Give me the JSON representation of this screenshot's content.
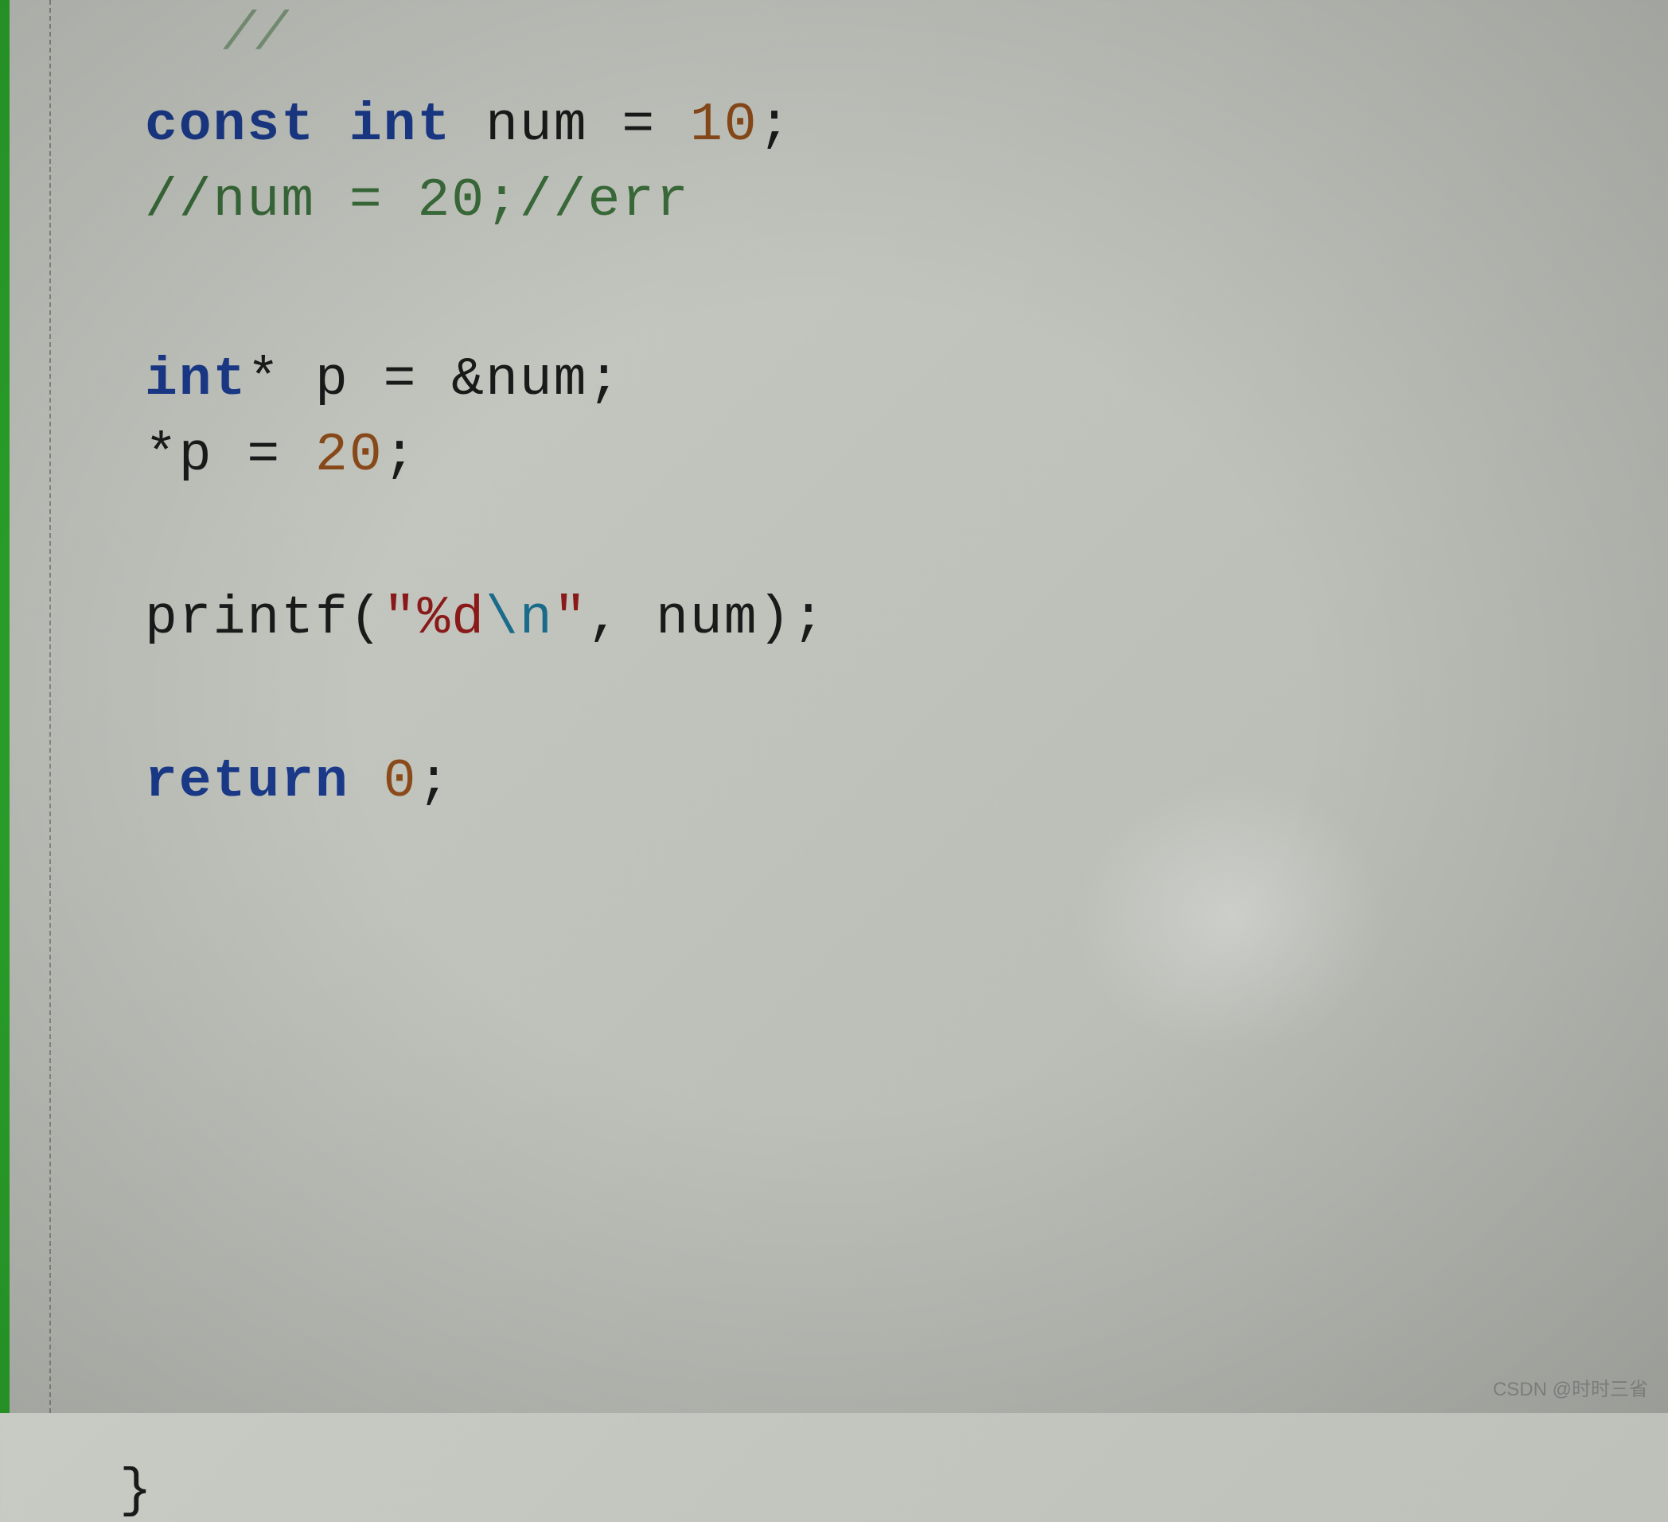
{
  "code": {
    "top_partial": "//",
    "line1": {
      "indent": "  ",
      "kw_const": "const",
      "sp1": " ",
      "kw_int": "int",
      "sp2": " ",
      "var": "num = ",
      "num": "10",
      "semi": ";"
    },
    "line2": {
      "indent": "  ",
      "comment": "//num = 20;//err"
    },
    "line3": {
      "indent": "  ",
      "kw_int": "int",
      "rest": "* p = &num;"
    },
    "line4": {
      "indent": "  ",
      "text": "*p = ",
      "num": "20",
      "semi": ";"
    },
    "line5": {
      "indent": "  ",
      "func": "printf(",
      "str1": "\"%d",
      "esc": "\\n",
      "str2": "\"",
      "rest": ", num);"
    },
    "line6": {
      "indent": "  ",
      "kw_return": "return",
      "sp": " ",
      "num": "0",
      "semi": ";"
    },
    "closing_brace": "}"
  },
  "watermark": "CSDN @时时三省"
}
